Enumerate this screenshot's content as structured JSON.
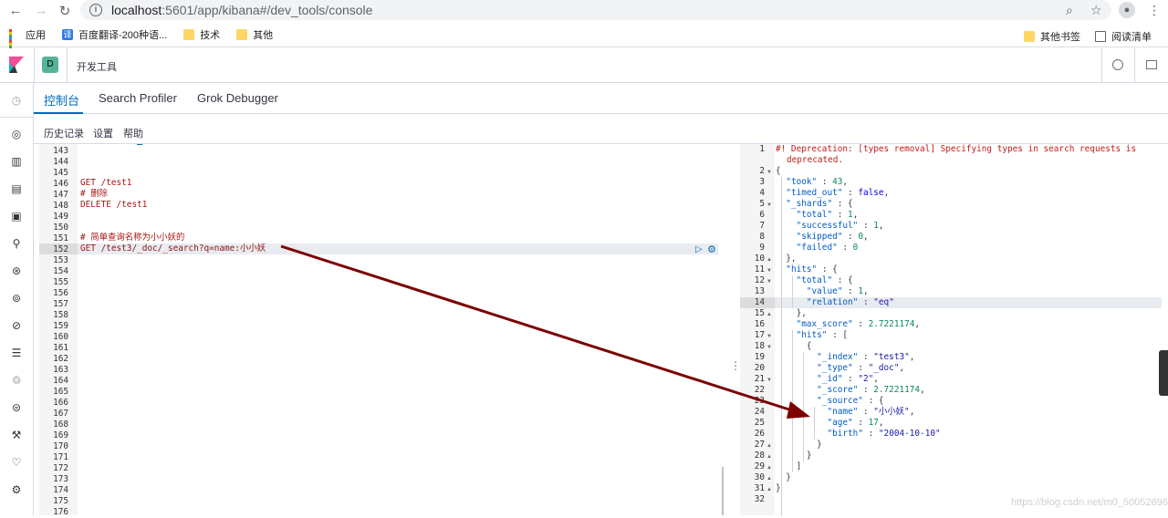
{
  "browser": {
    "url_host": "localhost",
    "url_path": ":5601/app/kibana#/dev_tools/console",
    "bookmarks": [
      {
        "label": "应用",
        "icon": "apps-icon"
      },
      {
        "label": "百度翻译-200种语...",
        "icon": "translate-icon"
      },
      {
        "label": "技术",
        "icon": "folder-icon"
      },
      {
        "label": "其他",
        "icon": "folder-icon"
      }
    ],
    "other_bookmarks": "其他书签",
    "reading_list": "阅读清单"
  },
  "kibana": {
    "space_initial": "D",
    "app_title": "开发工具",
    "tabs": [
      "控制台",
      "Search Profiler",
      "Grok Debugger"
    ],
    "subnav": [
      "历史记录",
      "设置",
      "帮助"
    ]
  },
  "request_editor": {
    "line_numbers": [
      "143",
      "144",
      "145",
      "146",
      "147",
      "148",
      "149",
      "150",
      "151",
      "152",
      "153",
      "154",
      "155",
      "156",
      "157",
      "158",
      "159",
      "160",
      "161",
      "162",
      "163",
      "164",
      "165",
      "166",
      "167",
      "168",
      "169",
      "170",
      "171",
      "172",
      "173",
      "174",
      "175",
      "176"
    ],
    "lines": {
      "l146": "GET /test1",
      "l147": "# 删除",
      "l148": "DELETE /test1",
      "l151": "# 简单查询名称为小小妖的",
      "l152_method": "GET",
      "l152_url": " /test3/_doc/_search?q=name:小小妖"
    }
  },
  "response_editor": {
    "line_numbers": [
      "1",
      "",
      "2",
      "3",
      "4",
      "5",
      "6",
      "7",
      "8",
      "9",
      "10",
      "11",
      "12",
      "13",
      "14",
      "15",
      "16",
      "17",
      "18",
      "19",
      "20",
      "21",
      "22",
      "23",
      "24",
      "25",
      "26",
      "27",
      "28",
      "29",
      "30",
      "31",
      "32"
    ],
    "deprecation_1": "#! Deprecation: [types removal] Specifying types in search requests is",
    "deprecation_2": "deprecated.",
    "lines": [
      "{",
      "  \"took\" : 43,",
      "  \"timed_out\" : false,",
      "  \"_shards\" : {",
      "    \"total\" : 1,",
      "    \"successful\" : 1,",
      "    \"skipped\" : 0,",
      "    \"failed\" : 0",
      "  },",
      "  \"hits\" : {",
      "    \"total\" : {",
      "      \"value\" : 1,",
      "      \"relation\" : \"eq\"",
      "    },",
      "    \"max_score\" : 2.7221174,",
      "    \"hits\" : [",
      "      {",
      "        \"_index\" : \"test3\",",
      "        \"_type\" : \"_doc\",",
      "        \"_id\" : \"2\",",
      "        \"_score\" : 2.7221174,",
      "        \"_source\" : {",
      "          \"name\" : \"小小妖\",",
      "          \"age\" : 17,",
      "          \"birth\" : \"2004-10-10\"",
      "        }",
      "      }",
      "    ]",
      "  }",
      "}",
      ""
    ]
  },
  "watermark": "https://blog.csdn.net/m0_50052896",
  "colors": {
    "accent": "#006bb4",
    "arrow": "#7b0000"
  }
}
